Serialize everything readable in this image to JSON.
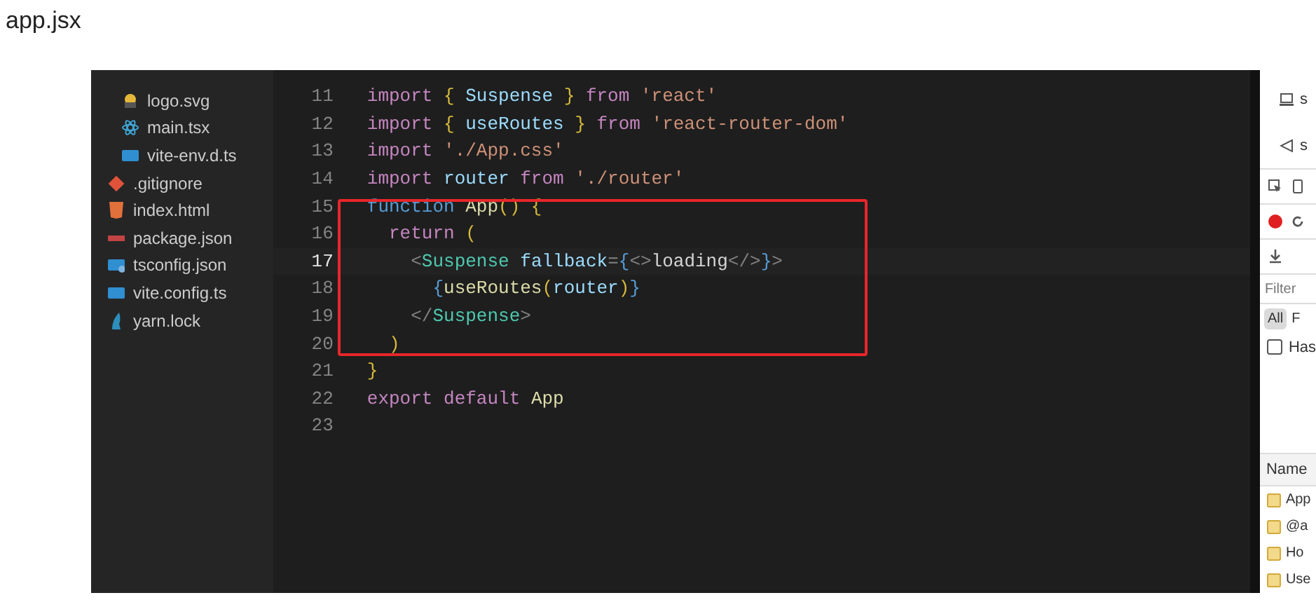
{
  "heading": "app.jsx",
  "explorer": {
    "files": [
      {
        "name": "logo.svg",
        "kind": "svg",
        "nested": true
      },
      {
        "name": "main.tsx",
        "kind": "react",
        "nested": true
      },
      {
        "name": "vite-env.d.ts",
        "kind": "ts",
        "nested": true
      },
      {
        "name": ".gitignore",
        "kind": "git",
        "nested": false
      },
      {
        "name": "index.html",
        "kind": "html",
        "nested": false
      },
      {
        "name": "package.json",
        "kind": "json",
        "nested": false
      },
      {
        "name": "tsconfig.json",
        "kind": "tsconfig",
        "nested": false
      },
      {
        "name": "vite.config.ts",
        "kind": "ts",
        "nested": false
      },
      {
        "name": "yarn.lock",
        "kind": "yarn",
        "nested": false
      }
    ]
  },
  "editor": {
    "lines": [
      {
        "number": "11",
        "current": false,
        "tokens": [
          {
            "kind": "keyword",
            "text": "import "
          },
          {
            "kind": "brace",
            "text": "{ "
          },
          {
            "kind": "name",
            "text": "Suspense"
          },
          {
            "kind": "brace",
            "text": " } "
          },
          {
            "kind": "keyword",
            "text": "from "
          },
          {
            "kind": "string",
            "text": "'react'"
          }
        ]
      },
      {
        "number": "12",
        "current": false,
        "tokens": [
          {
            "kind": "keyword",
            "text": "import "
          },
          {
            "kind": "brace",
            "text": "{ "
          },
          {
            "kind": "name",
            "text": "useRoutes"
          },
          {
            "kind": "brace",
            "text": " } "
          },
          {
            "kind": "keyword",
            "text": "from "
          },
          {
            "kind": "string",
            "text": "'react-router-dom'"
          }
        ]
      },
      {
        "number": "13",
        "current": false,
        "tokens": [
          {
            "kind": "keyword",
            "text": "import "
          },
          {
            "kind": "string",
            "text": "'./App.css'"
          }
        ]
      },
      {
        "number": "14",
        "current": false,
        "tokens": [
          {
            "kind": "keyword",
            "text": "import "
          },
          {
            "kind": "name",
            "text": "router "
          },
          {
            "kind": "keyword",
            "text": "from "
          },
          {
            "kind": "string",
            "text": "'./router'"
          }
        ]
      },
      {
        "number": "15",
        "current": false,
        "tokens": [
          {
            "kind": "storage",
            "text": "function "
          },
          {
            "kind": "function",
            "text": "App"
          },
          {
            "kind": "brace",
            "text": "() {"
          }
        ]
      },
      {
        "number": "16",
        "current": false,
        "tokens": [
          {
            "kind": "keyword",
            "text": "  return "
          },
          {
            "kind": "brace",
            "text": "("
          }
        ]
      },
      {
        "number": "17",
        "current": true,
        "tokens": [
          {
            "kind": "punct",
            "text": "    <"
          },
          {
            "kind": "tag",
            "text": "Suspense "
          },
          {
            "kind": "name",
            "text": "fallback"
          },
          {
            "kind": "punct",
            "text": "="
          },
          {
            "kind": "storage",
            "text": "{"
          },
          {
            "kind": "punct",
            "text": "<>"
          },
          {
            "kind": "plain",
            "text": "loading"
          },
          {
            "kind": "punct",
            "text": "</>"
          },
          {
            "kind": "storage",
            "text": "}"
          },
          {
            "kind": "punct",
            "text": ">"
          }
        ]
      },
      {
        "number": "18",
        "current": false,
        "tokens": [
          {
            "kind": "storage",
            "text": "      {"
          },
          {
            "kind": "function",
            "text": "useRoutes"
          },
          {
            "kind": "brace",
            "text": "("
          },
          {
            "kind": "name",
            "text": "router"
          },
          {
            "kind": "brace",
            "text": ")"
          },
          {
            "kind": "storage",
            "text": "}"
          }
        ]
      },
      {
        "number": "19",
        "current": false,
        "tokens": [
          {
            "kind": "punct",
            "text": "    </"
          },
          {
            "kind": "tag",
            "text": "Suspense"
          },
          {
            "kind": "punct",
            "text": ">"
          }
        ]
      },
      {
        "number": "20",
        "current": false,
        "tokens": [
          {
            "kind": "brace",
            "text": "  )"
          }
        ]
      },
      {
        "number": "21",
        "current": false,
        "tokens": [
          {
            "kind": "brace",
            "text": "}"
          }
        ]
      },
      {
        "number": "22",
        "current": false,
        "tokens": [
          {
            "kind": "keyword",
            "text": "export default "
          },
          {
            "kind": "function",
            "text": "App"
          }
        ]
      },
      {
        "number": "23",
        "current": false
      }
    ]
  },
  "devtools": {
    "top_items": [
      "s",
      "s"
    ],
    "filter": {
      "placeholder": "Filter"
    },
    "type_filters": [
      {
        "label": "All",
        "selected": true
      },
      {
        "label": "F",
        "selected": false
      }
    ],
    "has_checkbox": {
      "label": "Has",
      "checked": false
    },
    "name_header": "Name",
    "requests": [
      "App",
      "@a",
      "Ho",
      "Use"
    ]
  }
}
